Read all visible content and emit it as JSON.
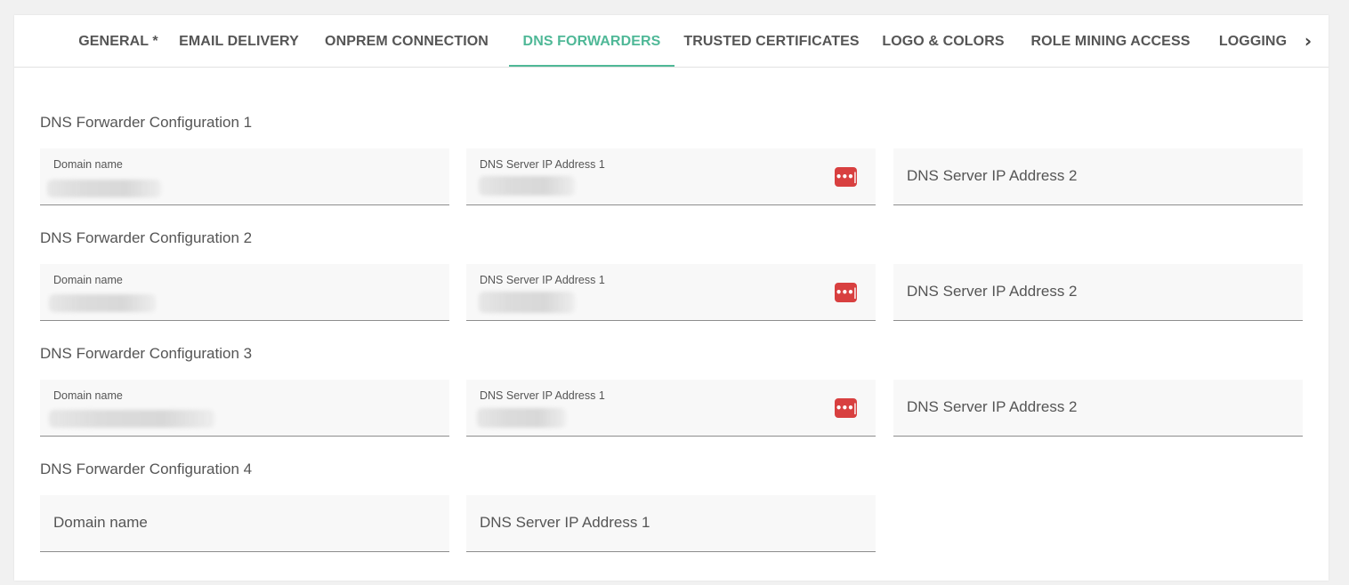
{
  "tabs": [
    {
      "label": "GENERAL *"
    },
    {
      "label": "EMAIL DELIVERY"
    },
    {
      "label": "ONPREM CONNECTION"
    },
    {
      "label": "DNS FORWARDERS"
    },
    {
      "label": "TRUSTED CERTIFICATES"
    },
    {
      "label": "LOGO & COLORS"
    },
    {
      "label": "ROLE MINING ACCESS"
    },
    {
      "label": "LOGGING"
    }
  ],
  "active_tab": "DNS FORWARDERS",
  "accent_color": "#4fb897",
  "password_icon_color": "#d84040",
  "tab_scroll_icon": "chevron-right-icon",
  "password_manager_glyph": "•••|",
  "configs": [
    {
      "title": "DNS Forwarder Configuration 1",
      "domain_label": "Domain name",
      "domain_value": "",
      "ip1_label": "DNS Server IP Address 1",
      "ip1_value": "",
      "ip2_label": "DNS Server IP Address 2"
    },
    {
      "title": "DNS Forwarder Configuration 2",
      "domain_label": "Domain name",
      "domain_value": "",
      "ip1_label": "DNS Server IP Address 1",
      "ip1_value": "",
      "ip2_label": "DNS Server IP Address 2"
    },
    {
      "title": "DNS Forwarder Configuration 3",
      "domain_label": "Domain name",
      "domain_value": "",
      "ip1_label": "DNS Server IP Address 1",
      "ip1_value": "",
      "ip2_label": "DNS Server IP Address 2"
    },
    {
      "title": "DNS Forwarder Configuration 4",
      "domain_label": "Domain name",
      "ip1_label": "DNS Server IP Address 1"
    }
  ]
}
